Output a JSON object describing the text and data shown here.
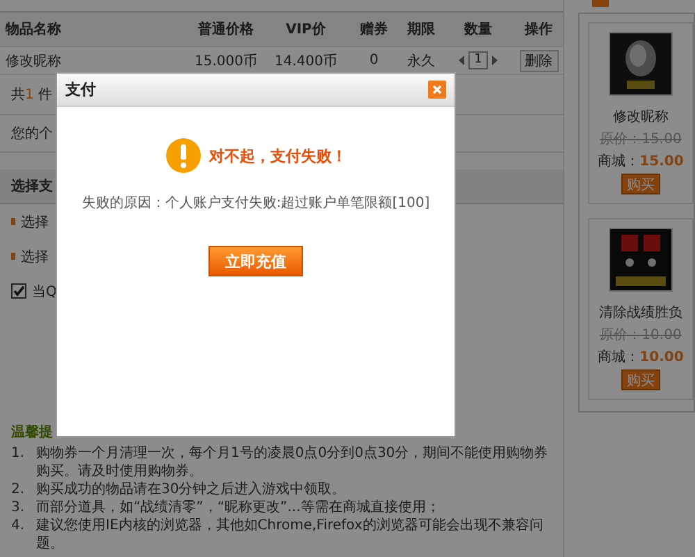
{
  "cart": {
    "columns": [
      "物品名称",
      "普通价格",
      "VIP价",
      "赠券",
      "期限",
      "数量",
      "操作"
    ],
    "rows": [
      {
        "name": "修改昵称",
        "price": "15.000币",
        "vip_price": "14.400币",
        "coupon": "0",
        "term": "永久",
        "quantity": "1",
        "action": "删除"
      }
    ],
    "summary": {
      "prefix": "共",
      "count": "1",
      "suffix": " 件"
    },
    "account": "您的个"
  },
  "payment": {
    "title": "选择支",
    "options": [
      "选择",
      "选择"
    ],
    "agreement": {
      "label": "当Q",
      "checked": true
    }
  },
  "tips": {
    "title": "温馨提",
    "items": [
      {
        "number": "1.",
        "text": "购物券一个月清理一次，每个月1号的凌晨0点0分到0点30分，期间不能使用购物券购买。请及时使用购物券。"
      },
      {
        "number": "2.",
        "text": "购买成功的物品请在30分钟之后进入游戏中领取。"
      },
      {
        "number": "3.",
        "text": "而部分道具，如“战绩清零”，“昵称更改”...等需在商城直接使用；"
      },
      {
        "number": "4.",
        "text": "建议您使用IE内核的浏览器，其他如Chrome,Firefox的浏览器可能会出现不兼容问题。"
      }
    ]
  },
  "recommended": [
    {
      "name": "修改昵称",
      "original_price": "原价：15.00",
      "mall_label": "商城：",
      "mall_price": "15.00",
      "buy": "购买"
    },
    {
      "name": "清除战绩胜负",
      "original_price": "原价：10.00",
      "mall_label": "商城：",
      "mall_price": "10.00",
      "buy": "购买"
    }
  ],
  "dialog": {
    "title": "支付",
    "message": "对不起，支付失败！",
    "reason": "失败的原因：个人账户支付失败:超过账户单笔限额[100]",
    "button": "立即充值"
  }
}
